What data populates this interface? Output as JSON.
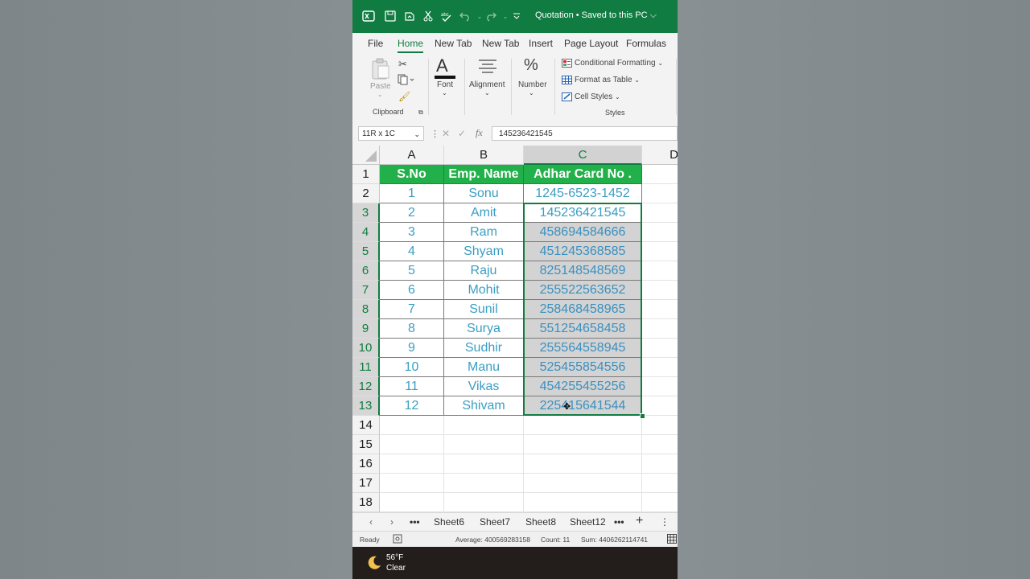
{
  "titlebar": {
    "title": "Quotation • Saved to this PC ⌵",
    "icons": [
      "excel-logo-icon",
      "save-icon",
      "autosave-icon",
      "cut-icon",
      "spelling-icon",
      "undo-icon",
      "redo-icon",
      "customize-qat-icon"
    ]
  },
  "tabs": [
    "File",
    "Home",
    "New Tab",
    "New Tab",
    "Insert",
    "Page Layout",
    "Formulas"
  ],
  "ribbon": {
    "paste_label": "Paste",
    "clipboard_label": "Clipboard",
    "font_label": "Font",
    "alignment_label": "Alignment",
    "number_label": "Number",
    "conditional_formatting": "Conditional Formatting",
    "format_as_table": "Format as Table",
    "cell_styles": "Cell Styles",
    "styles_label": "Styles"
  },
  "formula_bar": {
    "name_box": "11R x 1C",
    "fx": "fx",
    "value": "145236421545"
  },
  "sheet": {
    "columns": [
      "A",
      "B",
      "C",
      "D"
    ],
    "rows": [
      "1",
      "2",
      "3",
      "4",
      "5",
      "6",
      "7",
      "8",
      "9",
      "10",
      "11",
      "12",
      "13",
      "14",
      "15",
      "16",
      "17",
      "18"
    ],
    "header": [
      "S.No",
      "Emp. Name",
      "Adhar Card No ."
    ],
    "data": [
      [
        "1",
        "Sonu",
        "1245-6523-1452"
      ],
      [
        "2",
        "Amit",
        "145236421545"
      ],
      [
        "3",
        "Ram",
        "458694584666"
      ],
      [
        "4",
        "Shyam",
        "451245368585"
      ],
      [
        "5",
        "Raju",
        "825148548569"
      ],
      [
        "6",
        "Mohit",
        "255522563652"
      ],
      [
        "7",
        "Sunil",
        "258468458965"
      ],
      [
        "8",
        "Surya",
        "551254658458"
      ],
      [
        "9",
        "Sudhir",
        "255564558945"
      ],
      [
        "10",
        "Manu",
        "525455854556"
      ],
      [
        "11",
        "Vikas",
        "454255455256"
      ],
      [
        "12",
        "Shivam",
        "225415641544"
      ]
    ],
    "selected_column": "C",
    "selected_rows_from": "3",
    "selected_rows_to": "13"
  },
  "sheet_tabs": [
    "Sheet6",
    "Sheet7",
    "Sheet8",
    "Sheet12"
  ],
  "status": {
    "ready": "Ready",
    "average": "Average: 400569283158",
    "count": "Count: 11",
    "sum": "Sum: 4406262114741"
  },
  "taskbar": {
    "temp": "56°F",
    "condition": "Clear"
  },
  "colors": {
    "excel_green": "#107c41",
    "header_fill": "#22b04a",
    "data_text": "#3b9ec3",
    "highlight_fill": "#d3d3d3"
  }
}
